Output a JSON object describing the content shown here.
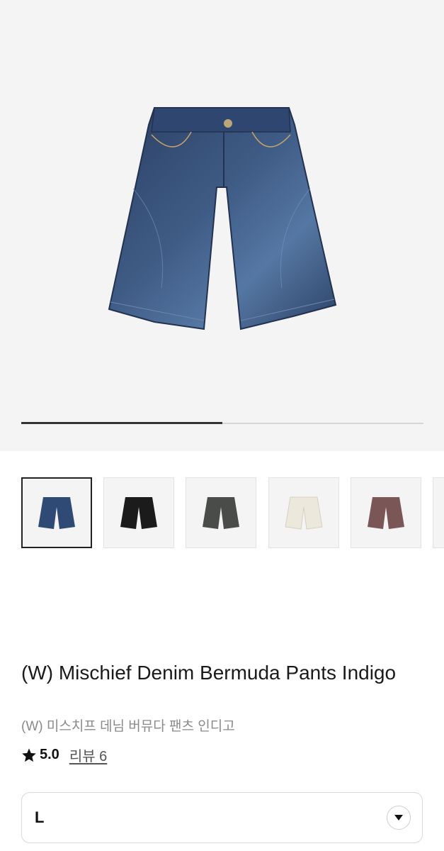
{
  "product": {
    "title": "(W) Mischief Denim Bermuda Pants Indigo",
    "subtitle": "(W) 미스치프 데님 버뮤다 팬츠 인디고",
    "rating": "5.0",
    "review_link": "리뷰 6"
  },
  "gallery": {
    "progress": 0.5,
    "main_image": "indigo-denim-shorts",
    "thumbnails": [
      {
        "name": "thumb-indigo",
        "color": "#2f4a74",
        "selected": true
      },
      {
        "name": "thumb-black",
        "color": "#1b1b1b",
        "selected": false
      },
      {
        "name": "thumb-washed-black",
        "color": "#4a4c4a",
        "selected": false
      },
      {
        "name": "thumb-ecru",
        "color": "#ece8dc",
        "selected": false
      },
      {
        "name": "thumb-brown",
        "color": "#7a5656",
        "selected": false
      },
      {
        "name": "thumb-partial",
        "color": "#f4f4f4",
        "selected": false
      }
    ]
  },
  "size_select": {
    "value": "L",
    "icon": "chevron-down-icon"
  },
  "colors": {
    "hero_bg": "#f4f4f4",
    "progress": "#333333"
  }
}
